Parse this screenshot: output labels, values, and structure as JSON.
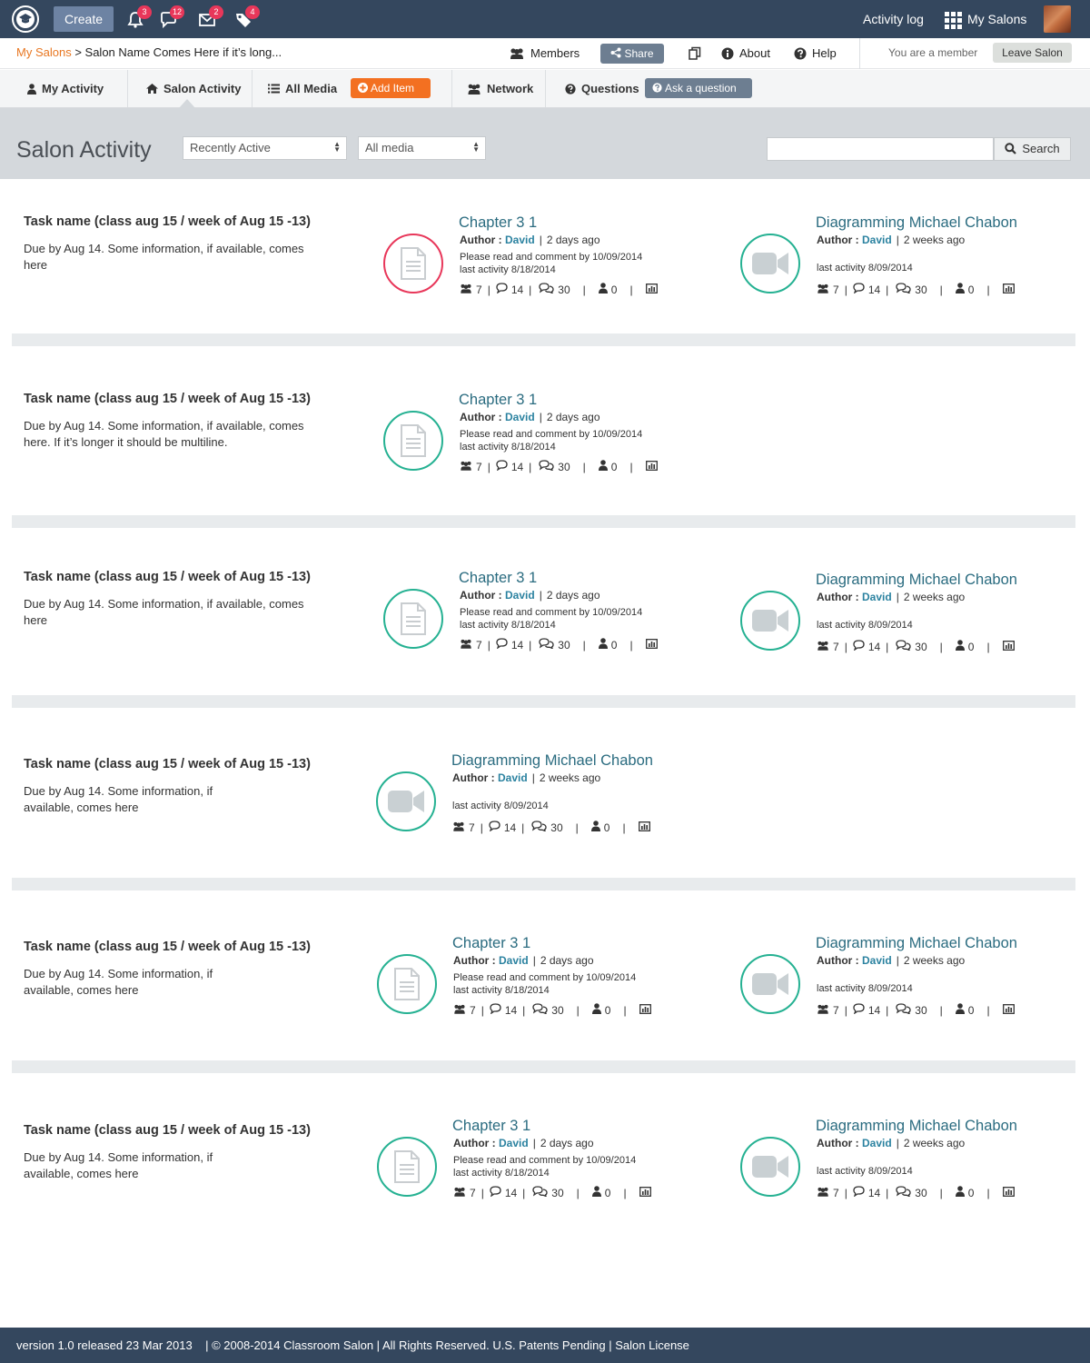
{
  "topbar": {
    "create_label": "Create",
    "notifications": [
      {
        "icon": "bell-icon",
        "count": "3"
      },
      {
        "icon": "chat-icon",
        "count": "12"
      },
      {
        "icon": "mail-icon",
        "count": "2"
      },
      {
        "icon": "tag-icon",
        "count": "4"
      }
    ],
    "activity_log": "Activity log",
    "my_salons": "My Salons"
  },
  "crumb": {
    "home": "My Salons",
    "current": "> Salon Name Comes Here if it’s long..."
  },
  "salon_actions": {
    "members": "Members",
    "share": "Share",
    "about": "About",
    "help": "Help",
    "member_status": "You are a member",
    "leave": "Leave Salon"
  },
  "tabs": {
    "my_activity": "My Activity",
    "salon_activity": "Salon Activity",
    "all_media": "All Media",
    "add_item": "Add Item",
    "network": "Network",
    "questions": "Questions",
    "ask_question": "Ask a question"
  },
  "header": {
    "title": "Salon Activity",
    "sort_select": "Recently Active",
    "media_select": "All media",
    "search_placeholder": "",
    "search_button": "Search"
  },
  "rows": [
    {
      "task_title": "Task name (class aug 15 / week of Aug 15 -13)",
      "task_desc": "Due by Aug 14. Some information, if available, comes here",
      "doc": {
        "title": "Chapter 3 1",
        "author_label": "Author :",
        "author": "David",
        "age": "2 days ago",
        "note1": "Please read and comment by 10/09/2014",
        "note2": "last activity 8/18/2014",
        "members": "7",
        "comments": "14",
        "replies": "30",
        "users": "0"
      },
      "video": {
        "title": "Diagramming Michael Chabon",
        "author_label": "Author :",
        "author": "David",
        "age": "2 weeks ago",
        "note2": "last activity 8/09/2014",
        "members": "7",
        "comments": "14",
        "replies": "30",
        "users": "0"
      }
    },
    {
      "task_title": "Task name (class aug 15 / week of Aug 15 -13)",
      "task_desc": "Due by Aug 14. Some information, if available, comes here. If it’s longer it should be multiline.",
      "doc": {
        "title": "Chapter 3 1",
        "author_label": "Author :",
        "author": "David",
        "age": "2 days ago",
        "note1": "Please read and comment by 10/09/2014",
        "note2": "last activity 8/18/2014",
        "members": "7",
        "comments": "14",
        "replies": "30",
        "users": "0"
      }
    },
    {
      "task_title": "Task name (class aug 15 / week of Aug 15 -13)",
      "task_desc": "Due by Aug 14. Some information, if available, comes here",
      "doc": {
        "title": "Chapter 3 1",
        "author_label": "Author :",
        "author": "David",
        "age": "2 days ago",
        "note1": "Please read and comment by 10/09/2014",
        "note2": "last activity 8/18/2014",
        "members": "7",
        "comments": "14",
        "replies": "30",
        "users": "0"
      },
      "video": {
        "title": "Diagramming Michael Chabon",
        "author_label": "Author :",
        "author": "David",
        "age": "2 weeks ago",
        "note2": "last activity 8/09/2014",
        "members": "7",
        "comments": "14",
        "replies": "30",
        "users": "0"
      }
    },
    {
      "task_title": "Task name (class aug 15 / week of Aug 15 -13)",
      "task_desc": "Due by Aug 14. Some information, if available, comes here",
      "video": {
        "title": "Diagramming Michael Chabon",
        "author_label": "Author :",
        "author": "David",
        "age": "2 weeks ago",
        "note2": "last activity 8/09/2014",
        "members": "7",
        "comments": "14",
        "replies": "30",
        "users": "0"
      }
    },
    {
      "task_title": "Task name (class aug 15 / week of Aug 15 -13)",
      "task_desc": "Due by Aug 14. Some information, if available, comes here",
      "doc": {
        "title": "Chapter 3 1",
        "author_label": "Author :",
        "author": "David",
        "age": "2 days ago",
        "note1": "Please read and comment by 10/09/2014",
        "note2": "last activity 8/18/2014",
        "members": "7",
        "comments": "14",
        "replies": "30",
        "users": "0"
      },
      "video": {
        "title": "Diagramming Michael Chabon",
        "author_label": "Author :",
        "author": "David",
        "age": "2 weeks ago",
        "note2": "last activity 8/09/2014",
        "members": "7",
        "comments": "14",
        "replies": "30",
        "users": "0"
      }
    },
    {
      "task_title": "Task name (class aug 15 / week of Aug 15 -13)",
      "task_desc": "Due by Aug 14. Some information, if available, comes here",
      "doc": {
        "title": "Chapter 3 1",
        "author_label": "Author :",
        "author": "David",
        "age": "2 days ago",
        "note1": "Please read and comment by 10/09/2014",
        "note2": "last activity 8/18/2014",
        "members": "7",
        "comments": "14",
        "replies": "30",
        "users": "0"
      },
      "video": {
        "title": "Diagramming Michael Chabon",
        "author_label": "Author :",
        "author": "David",
        "age": "2 weeks ago",
        "note2": "last activity 8/09/2014",
        "members": "7",
        "comments": "14",
        "replies": "30",
        "users": "0"
      }
    }
  ],
  "footer": {
    "text": "version 1.0 released 23 Mar 2013    | © 2008-2014 Classroom Salon | All Rights Reserved. U.S. Patents Pending | Salon License"
  },
  "colors": {
    "topbar": "#34475e",
    "accent_teal": "#25b192",
    "accent_red": "#e8375a",
    "orange": "#f37021",
    "link": "#2b6c80"
  }
}
